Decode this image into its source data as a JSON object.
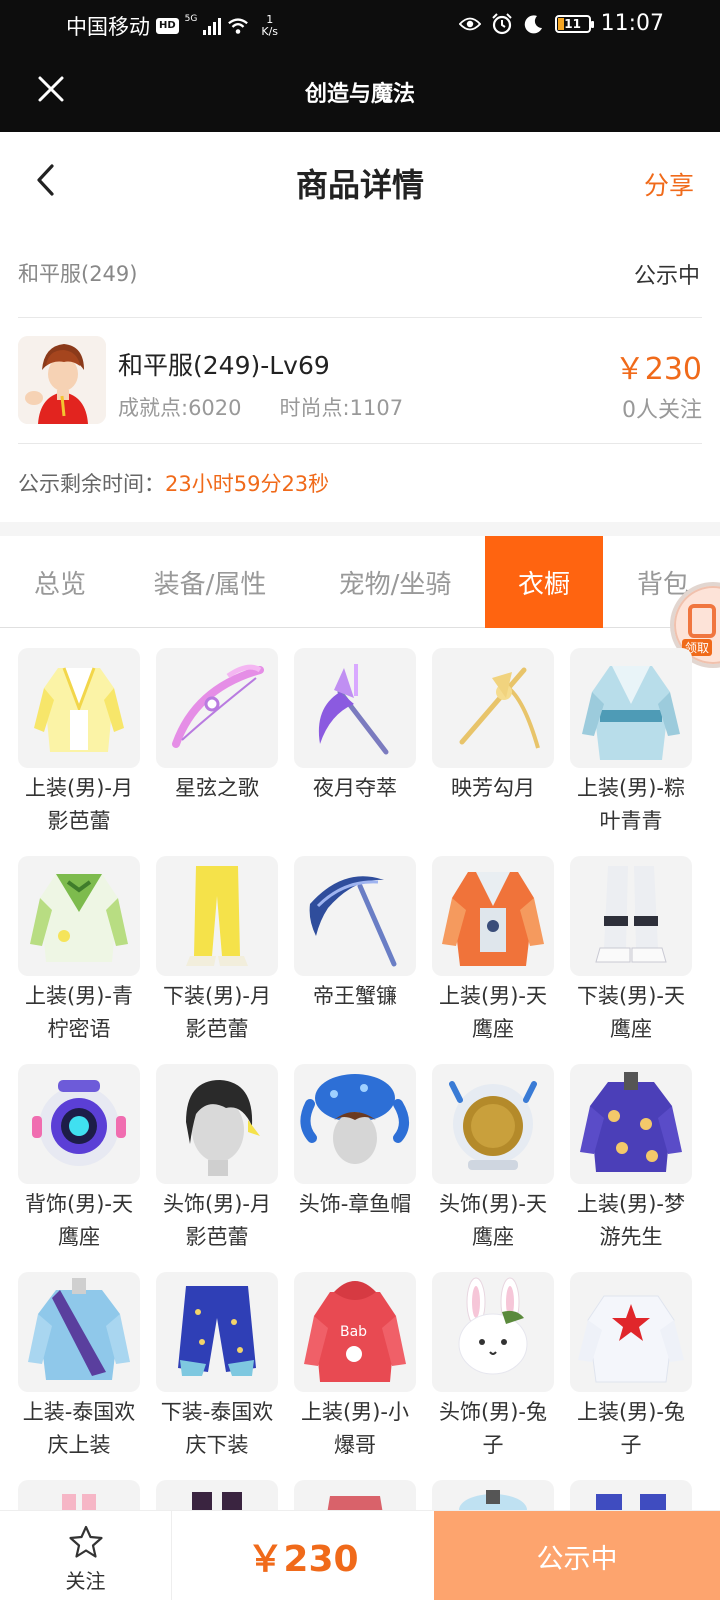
{
  "status_bar": {
    "carrier": "中国移动",
    "hd_badge": "HD",
    "network": "5G",
    "speed_value": "1",
    "speed_unit": "K/s",
    "battery": "11",
    "time": "11:07"
  },
  "webview": {
    "title": "创造与魔法"
  },
  "header": {
    "title": "商品详情",
    "share_label": "分享"
  },
  "server": {
    "name": "和平服(249)",
    "status": "公示中"
  },
  "role": {
    "name": "和平服(249)-Lv69",
    "achievement": "成就点:6020",
    "fashion": "时尚点:1107",
    "price": "￥230",
    "followers": "0人关注"
  },
  "countdown": {
    "label": "公示剩余时间：",
    "value": "23小时59分23秒"
  },
  "tabs": [
    {
      "label": "总览",
      "active": false
    },
    {
      "label": "装备/属性",
      "active": false
    },
    {
      "label": "宠物/坐骑",
      "active": false
    },
    {
      "label": "衣橱",
      "active": true
    },
    {
      "label": "背包",
      "active": false
    }
  ],
  "float_badge": {
    "label": "领取"
  },
  "wardrobe": [
    {
      "label": "上装(男)-月影芭蕾",
      "icon": "white-yellow-jacket-icon"
    },
    {
      "label": "星弦之歌",
      "icon": "pink-bow-icon"
    },
    {
      "label": "夜月夺萃",
      "icon": "purple-scythe-icon"
    },
    {
      "label": "映芳勾月",
      "icon": "golden-staff-icon"
    },
    {
      "label": "上装(男)-粽叶青青",
      "icon": "blue-robe-icon"
    },
    {
      "label": "上装(男)-青柠密语",
      "icon": "green-suit-icon"
    },
    {
      "label": "下装(男)-月影芭蕾",
      "icon": "yellow-pants-icon"
    },
    {
      "label": "帝王蟹镰",
      "icon": "crab-scythe-icon"
    },
    {
      "label": "上装(男)-天鹰座",
      "icon": "orange-armor-icon"
    },
    {
      "label": "下装(男)-天鹰座",
      "icon": "white-boots-icon"
    },
    {
      "label": "背饰(男)-天鹰座",
      "icon": "round-backpack-icon"
    },
    {
      "label": "头饰(男)-月影芭蕾",
      "icon": "black-hair-icon"
    },
    {
      "label": "头饰-章鱼帽",
      "icon": "octopus-hat-icon"
    },
    {
      "label": "头饰(男)-天鹰座",
      "icon": "space-helmet-icon"
    },
    {
      "label": "上装(男)-梦游先生",
      "icon": "purple-pajamas-icon"
    },
    {
      "label": "上装-泰国欢庆上装",
      "icon": "blue-sash-top-icon"
    },
    {
      "label": "下装-泰国欢庆下装",
      "icon": "blue-star-pants-icon"
    },
    {
      "label": "上装(男)-小爆哥",
      "icon": "red-hoodie-icon"
    },
    {
      "label": "头饰(男)-兔子",
      "icon": "bunny-hat-icon"
    },
    {
      "label": "上装(男)-兔子",
      "icon": "bunny-suit-icon"
    }
  ],
  "bottom_bar": {
    "follow_label": "关注",
    "price": "￥230",
    "action_label": "公示中"
  },
  "colors": {
    "accent": "#ff6410",
    "price": "#f06a1a",
    "action_bg": "#fda46e"
  }
}
